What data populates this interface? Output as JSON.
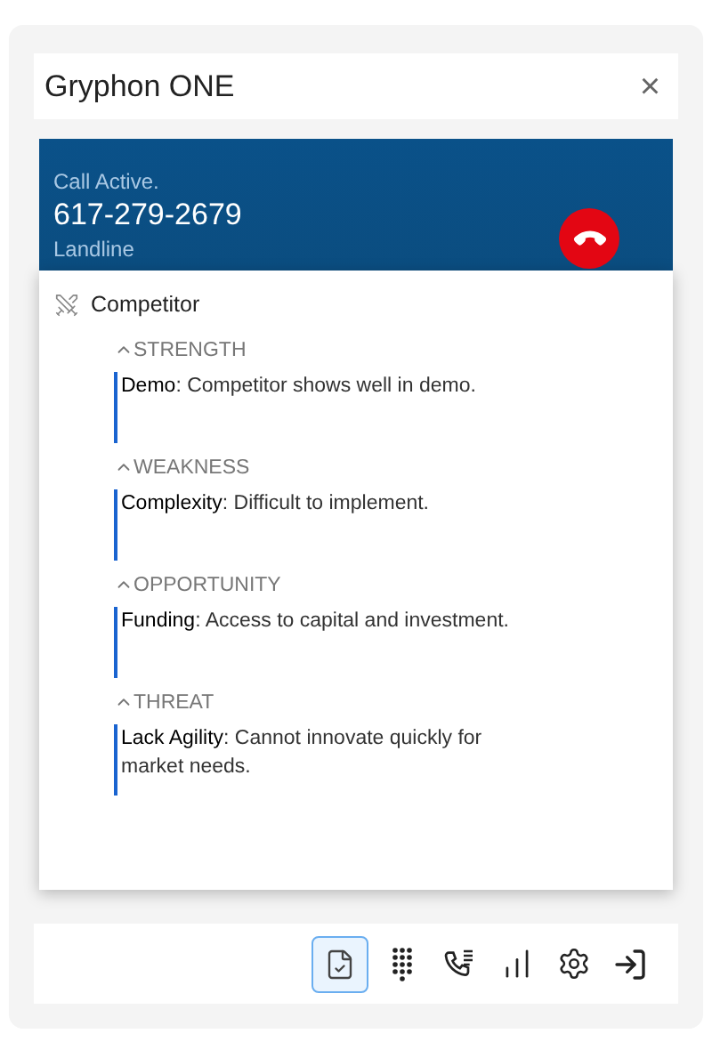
{
  "window": {
    "title": "Gryphon ONE",
    "close": "×"
  },
  "call": {
    "status": "Call Active.",
    "number": "617-279-2679",
    "line_type": "Landline"
  },
  "panel": {
    "title": "Competitor",
    "sections": [
      {
        "label": "STRENGTH",
        "expanded": true,
        "items": [
          "**Demo**: Competitor shows well in demo."
        ]
      },
      {
        "label": "WEAKNESS",
        "expanded": true,
        "items": [
          "**Complexity**: Difficult to implement."
        ]
      },
      {
        "label": "OPPORTUNITY",
        "expanded": true,
        "items": [
          "**Funding**: Access to capital and investment."
        ]
      },
      {
        "label": "THREAT",
        "expanded": true,
        "items": [
          "**Lack Agility**: Cannot innovate quickly for market needs."
        ]
      }
    ]
  },
  "toolbar": [
    {
      "kind": "notes",
      "selected": true
    },
    {
      "kind": "keypad",
      "selected": false
    },
    {
      "kind": "call-log",
      "selected": false
    },
    {
      "kind": "stats",
      "selected": false
    },
    {
      "kind": "settings",
      "selected": false
    },
    {
      "kind": "exit",
      "selected": false
    }
  ]
}
